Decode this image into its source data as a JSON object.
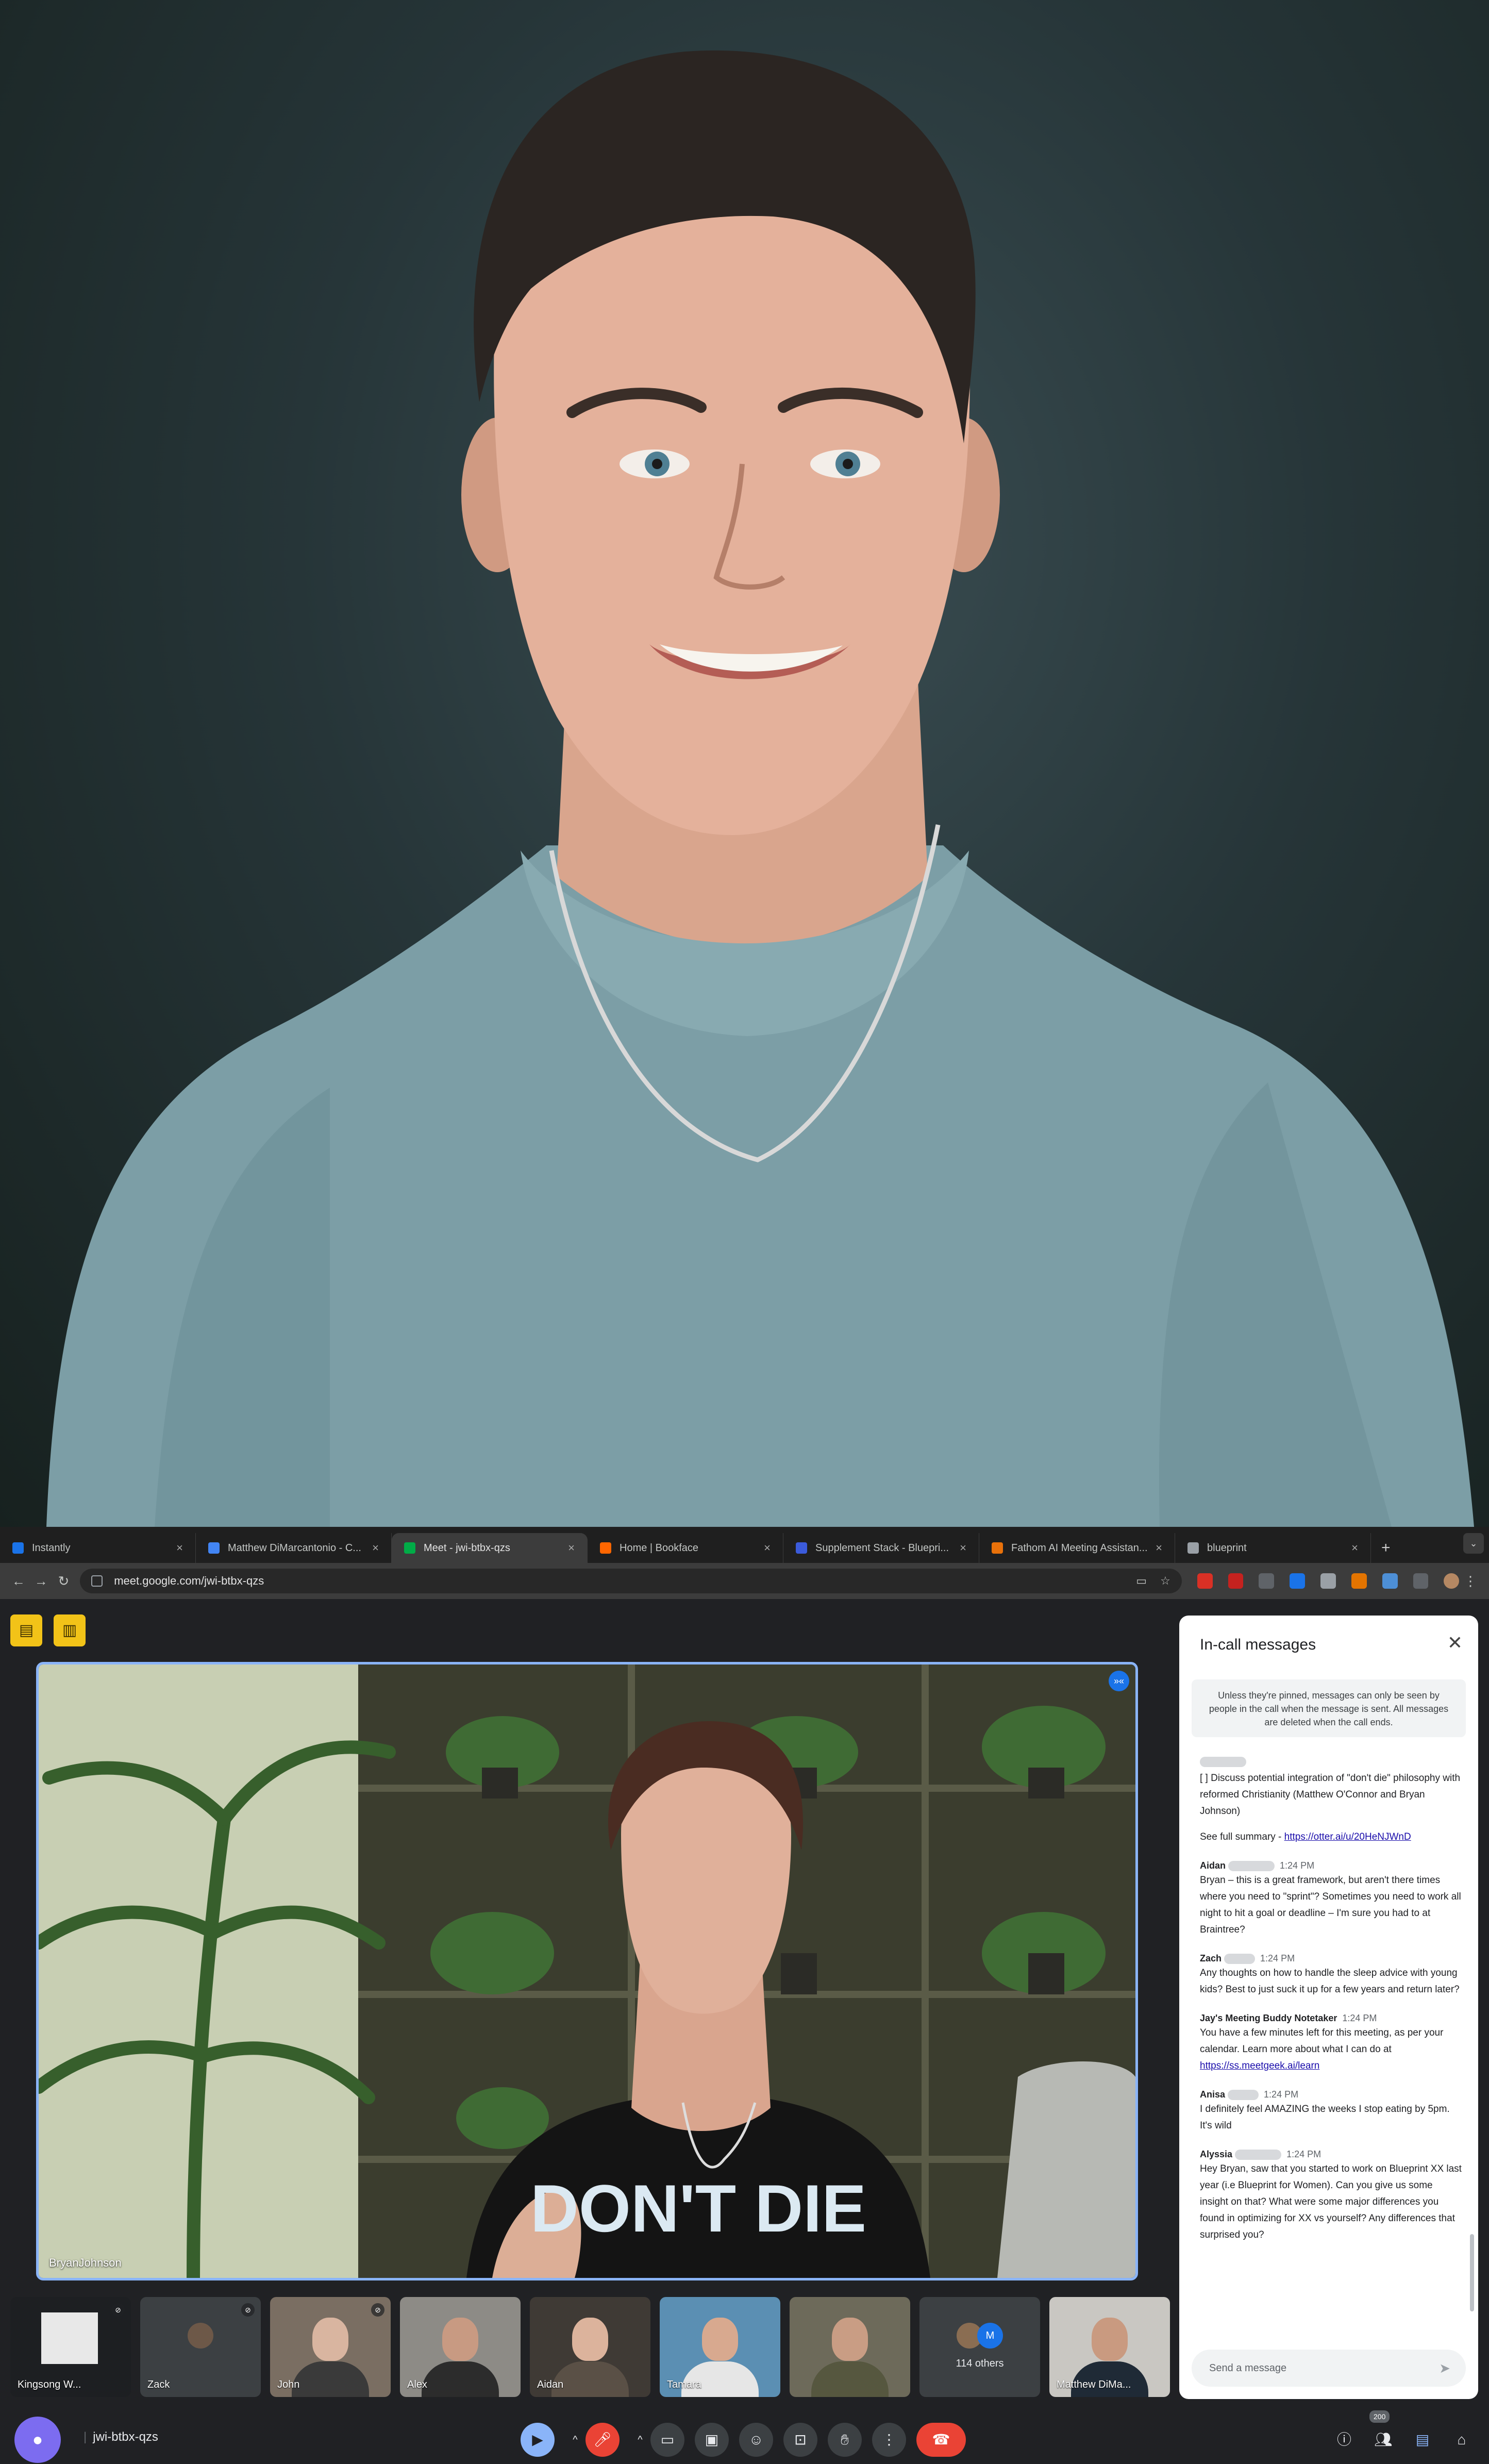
{
  "browser": {
    "tabs": [
      {
        "label": "Instantly",
        "favicon_color": "#1a73e8"
      },
      {
        "label": "Matthew DiMarcantonio - C...",
        "favicon_color": "#4285f4"
      },
      {
        "label": "Meet - jwi-btbx-qzs",
        "favicon_color": "#00ac47"
      },
      {
        "label": "Home | Bookface",
        "favicon_color": "#ff6600"
      },
      {
        "label": "Supplement Stack - Bluepri...",
        "favicon_color": "#3b5bdb"
      },
      {
        "label": "Fathom AI Meeting Assistan...",
        "favicon_color": "#e8710a"
      },
      {
        "label": "blueprint",
        "favicon_color": "#9aa0a6"
      }
    ],
    "tab_close": "×",
    "new_tab": "+",
    "url": "meet.google.com/jwi-btbx-qzs"
  },
  "meet": {
    "stage": {
      "name": "BryanJohnson",
      "shirt_text": "DON'T DIE",
      "badge": "»«"
    },
    "participants": [
      {
        "name": "Kingsong W...",
        "bg": "#1d1f22"
      },
      {
        "name": "Zack",
        "bg": "#3c4043"
      },
      {
        "name": "John",
        "bg": "#7a6e62"
      },
      {
        "name": "Alex",
        "bg": "#8d8b86"
      },
      {
        "name": "Aidan",
        "bg": "#3f3a35"
      },
      {
        "name": "Tamara",
        "bg": "#5b8fb3"
      },
      {
        "name": "",
        "bg": "#6d6a5a"
      },
      {
        "name": "114 others",
        "bg": "#3c4043"
      },
      {
        "name": "Matthew DiMa...",
        "bg": "#c9c7c2"
      }
    ],
    "others_initial": "M",
    "meeting_code": "jwi-btbx-qzs",
    "participant_count": "200",
    "chat": {
      "title": "In-call messages",
      "notice": "Unless they're pinned, messages can only be seen by people in the call when the message is sent. All messages are deleted when the call ends.",
      "summary_item": "[ ] Discuss potential integration of \"don't die\" philosophy with reformed Christianity (Matthew O'Connor and Bryan Johnson)",
      "summary_link_prefix": "See full summary - ",
      "summary_link": "https://otter.ai/u/20HeNJWnD",
      "messages": [
        {
          "sender": "Aidan",
          "time": "1:24 PM",
          "text": "Bryan – this is a great framework, but aren't there times where you need to \"sprint\"? Sometimes you need to work all night to hit a goal or deadline – I'm sure you had to at Braintree?"
        },
        {
          "sender": "Zach",
          "time": "1:24 PM",
          "text": "Any thoughts on how to handle the sleep advice with young kids? Best to just suck it up for a few years and return later?"
        },
        {
          "sender": "Jay's Meeting Buddy Notetaker",
          "time": "1:24 PM",
          "text": "You have a few minutes left for this meeting, as per your calendar. Learn more about what I can do at ",
          "link": "https://ss.meetgeek.ai/learn"
        },
        {
          "sender": "Anisa",
          "time": "1:24 PM",
          "text": "I definitely feel AMAZING the weeks I stop eating by 5pm. It's wild"
        },
        {
          "sender": "Alyssia",
          "time": "1:24 PM",
          "text": "Hey Bryan, saw that you started to work on Blueprint XX last year (i.e Blueprint for Women). Can you give us some insight on that? What were some major differences you found in optimizing for XX vs yourself? Any differences that surprised you?"
        }
      ],
      "input_placeholder": "Send a message"
    }
  },
  "colors": {
    "accent": "#8ab4f8",
    "end_call": "#ea4335",
    "yellow_tool": "#f2c318"
  }
}
